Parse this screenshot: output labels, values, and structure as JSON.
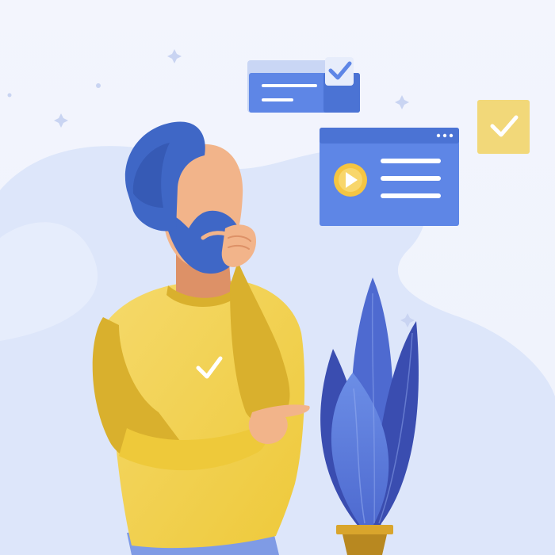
{
  "illustration": {
    "palette": {
      "background_top": "#F3F5FD",
      "background_bottom": "#EEF2FC",
      "blob": "#DDE6FA",
      "blob_light": "#E9EFFC",
      "hair": "#3F67C6",
      "hair_shadow": "#2F50A8",
      "skin": "#F2B48A",
      "skin_shadow": "#DD9167",
      "shirt": "#EEC93A",
      "shirt_light": "#F5D96A",
      "shirt_shadow": "#D9B02D",
      "pants": "#7F9BE5",
      "player_card": "#5E86E6",
      "player_card_bar": "#4B73D4",
      "play_button": "#F5C542",
      "sticky_note": "#F2D879",
      "leaf_dark": "#3A4DB0",
      "leaf_mid": "#4E6AD0",
      "leaf_light": "#6C8EE6",
      "pot": "#D9A52C",
      "pot_dark": "#B88820",
      "sparkle": "#C9D4F2"
    },
    "icons": [
      "checkmark-icon",
      "play-icon",
      "window-dots-icon",
      "sparkle-icon"
    ]
  }
}
